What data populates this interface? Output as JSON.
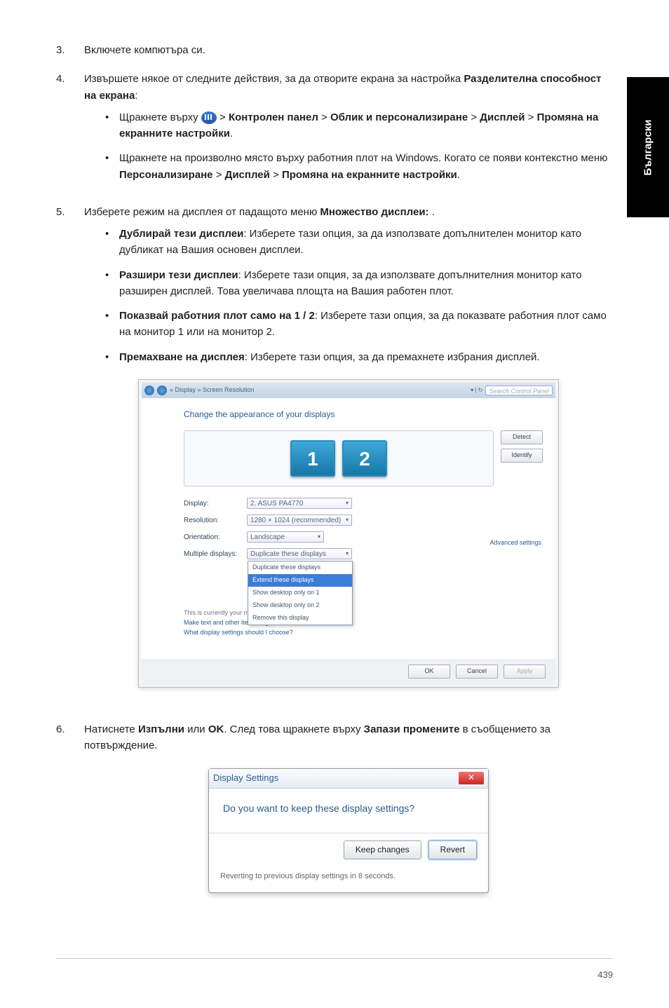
{
  "sidetab": "Български",
  "steps": {
    "s3": {
      "num": "3.",
      "text": "Включете компютъра си."
    },
    "s4": {
      "num": "4.",
      "text_a": "Извършете някое от следните действия, за да отворите екрана за настройка ",
      "bold_a": "Разделителна способност на екрана",
      "text_b": ":",
      "sub1": {
        "a": "Щракнете върху ",
        "b": " > ",
        "p1": "Контролен панел",
        "p2": "Облик и персонализиране",
        "p3": "Дисплей",
        "p4": "Промяна на екранните настройки",
        "dot": "."
      },
      "sub2": {
        "a": "Щракнете на произволно място върху работния плот на Windows. Когато се появи контекстно меню  ",
        "p1": "Персонализиране",
        "p2": "Дисплей",
        "p3": "Промяна на екранните настройки",
        "dot": "."
      }
    },
    "s5": {
      "num": "5.",
      "a": "Изберете режим на дисплея от падащото меню ",
      "b": "Множество дисплеи:",
      "c": " .",
      "sub1": {
        "t": "Дублирай тези дисплеи",
        "d": ": Изберете тази опция, за да използвате допълнителен монитор като дубликат на Вашия основен дисплеи."
      },
      "sub2": {
        "t": "Разшири тези дисплеи",
        "d": ": Изберете тази опция, за да използвате допълнителния монитор като разширен дисплей. Това увеличава площта на Вашия работен плот."
      },
      "sub3": {
        "t": "Показвай работния плот само на 1 / 2",
        "d": ": Изберете тази опция, за да показвате работния плот само на монитор 1 или на монитор 2."
      },
      "sub4": {
        "t": "Премахване на дисплея",
        "d": ": Изберете тази опция, за да премахнете избрания дисплей."
      }
    },
    "s6": {
      "num": "6.",
      "a": "Натиснете ",
      "b1": "Изпълни",
      "c": " или ",
      "b2": "OK",
      "d": ". След това щракнете върху ",
      "b3": "Запази промените",
      "e": " в съобщението за потвърждение."
    }
  },
  "win1": {
    "breadcrumb": "« Display » Screen Resolution",
    "searchph": "Search Control Panel",
    "heading": "Change the appearance of your displays",
    "detect": "Detect",
    "identify": "Identify",
    "mon1": "1",
    "mon2": "2",
    "rows": {
      "display": {
        "lbl": "Display:",
        "val": "2. ASUS PA4770"
      },
      "resolution": {
        "lbl": "Resolution:",
        "val": "1280 × 1024 (recommended)"
      },
      "orientation": {
        "lbl": "Orientation:",
        "val": "Landscape"
      },
      "multiple": {
        "lbl": "Multiple displays:",
        "val": "Duplicate these displays"
      }
    },
    "dropdown": {
      "o1": "Duplicate these displays",
      "o2": "Extend these displays",
      "o3": "Show desktop only on 1",
      "o4": "Show desktop only on 2",
      "o5": "Remove this display"
    },
    "note1": "This is currently your main display.",
    "note2": "Make text and other items larger or smaller",
    "note3": "What display settings should I choose?",
    "adv": "Advanced settings",
    "ok": "OK",
    "cancel": "Cancel",
    "apply": "Apply"
  },
  "win2": {
    "title": "Display Settings",
    "msg": "Do you want to keep these display settings?",
    "keep": "Keep changes",
    "revert": "Revert",
    "countdown": "Reverting to previous display settings in 8 seconds."
  },
  "pagenum": "439"
}
